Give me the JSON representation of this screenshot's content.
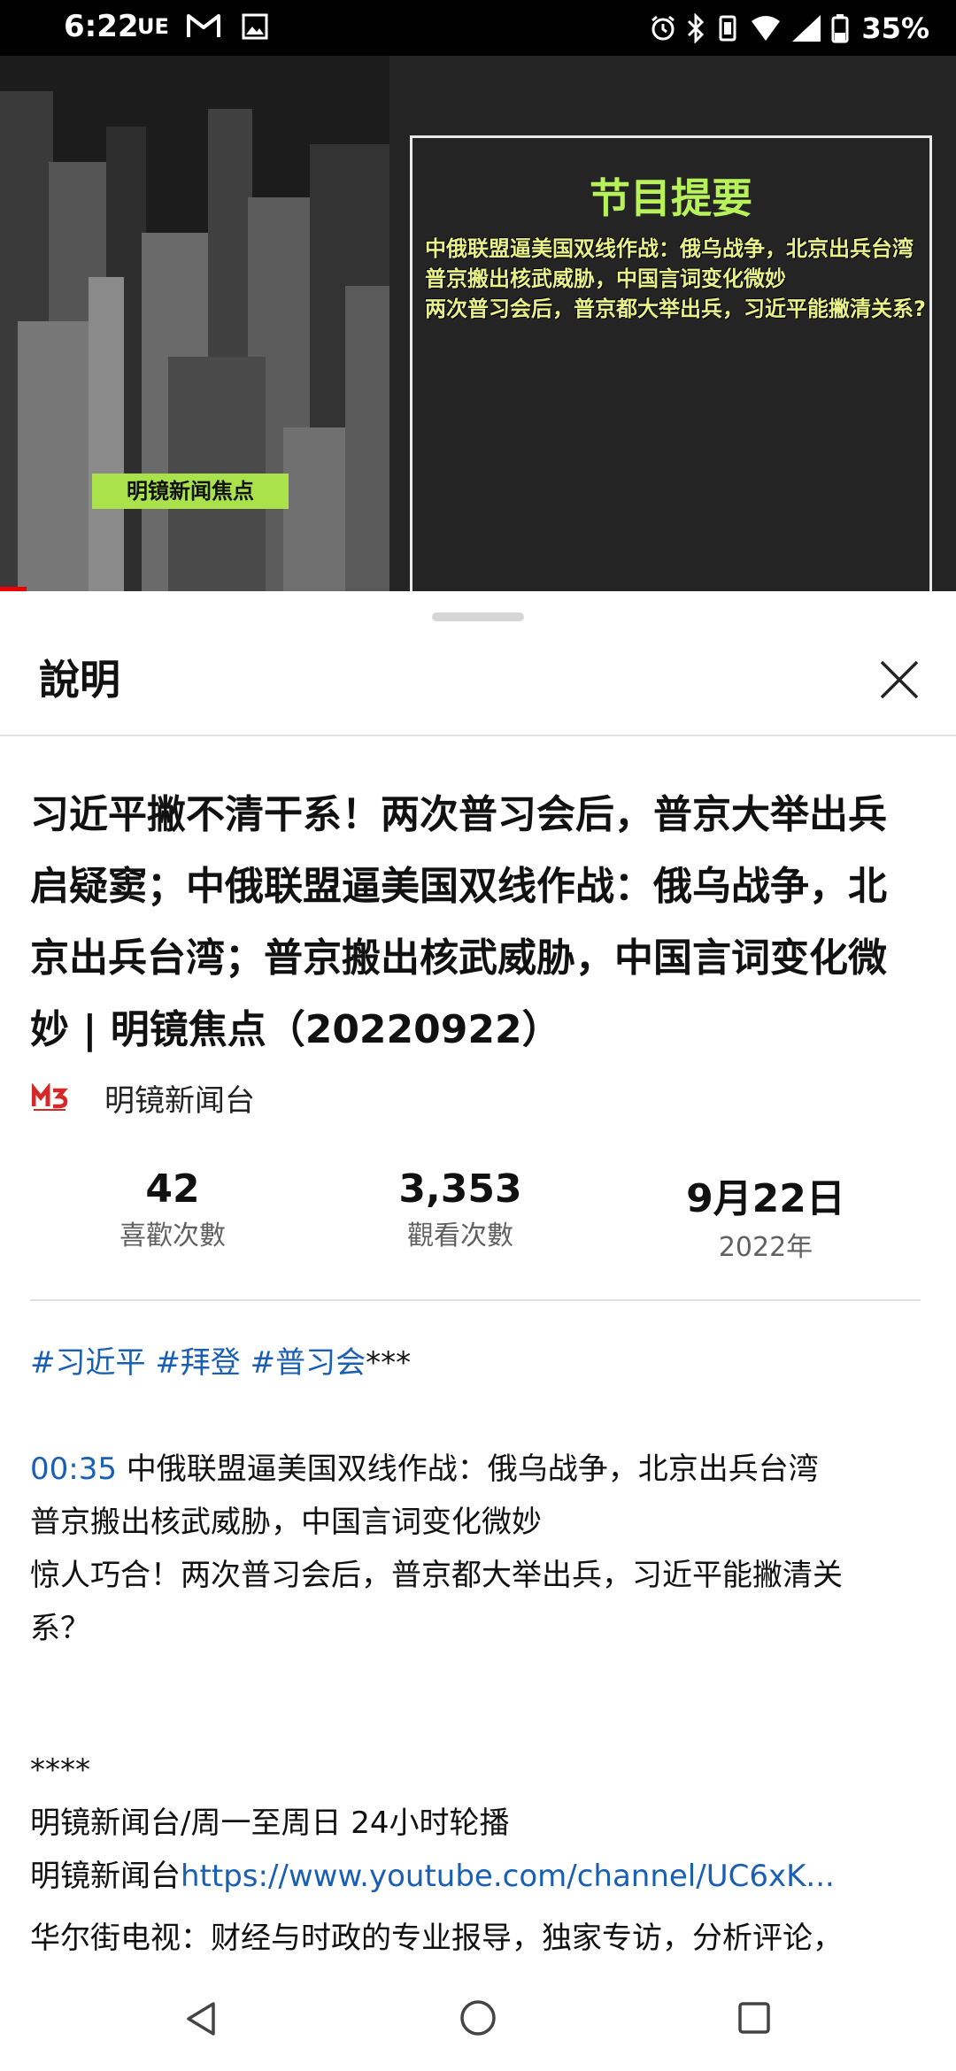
{
  "status": {
    "time": "6:22",
    "carrier": "UE",
    "battery": "35%",
    "icons": [
      "gmail-icon",
      "image-icon",
      "alarm-icon",
      "bluetooth-icon",
      "vibrate-icon",
      "wifi-icon",
      "signal-icon",
      "battery-icon"
    ]
  },
  "video": {
    "summary_title": "节目提要",
    "summary_lines": [
      "中俄联盟逼美国双线作战：俄乌战争，北京出兵台湾",
      "普京搬出核武威胁，中国言词变化微妙",
      "两次普习会后，普京都大举出兵，习近平能撇清关系?"
    ],
    "channel_tag": "明镜新闻焦点"
  },
  "sheet": {
    "title": "說明",
    "video_title": "习近平撇不清干系！两次普习会后，普京大举出兵启疑窦；中俄联盟逼美国双线作战：俄乌战争，北京出兵台湾；普京搬出核武威胁，中国言词变化微妙 | 明镜焦点（20220922）",
    "channel_name": "明镜新闻台",
    "channel_logo_text": "M3",
    "stats": {
      "likes_value": "42",
      "likes_label": "喜歡次數",
      "views_value": "3,353",
      "views_label": "觀看次數",
      "date_value": "9月22日",
      "date_label": "2022年"
    },
    "description": {
      "hashtags": [
        "#习近平",
        "#拜登",
        "#普习会"
      ],
      "hashtag_suffix": "***",
      "timestamp": "00:35",
      "line1": " 中俄联盟逼美国双线作战：俄乌战争，北京出兵台湾",
      "line2": "普京搬出核武威胁，中国言词变化微妙",
      "line3": "惊人巧合！两次普习会后，普京都大举出兵，习近平能撇清关",
      "line4": "系？",
      "stars": "****",
      "line5": "明镜新闻台/周一至周日 24小时轮播",
      "line6_prefix": "明镜新闻台",
      "line6_link": "https://www.youtube.com/channel/UC6xK...",
      "line7": "华尔街电视：财经与时政的专业报导，独家专访，分析评论，"
    }
  },
  "colors": {
    "accent_link": "#1a5fb4",
    "summary_title": "#b8f25a",
    "tag_bg": "#a9e24a"
  }
}
